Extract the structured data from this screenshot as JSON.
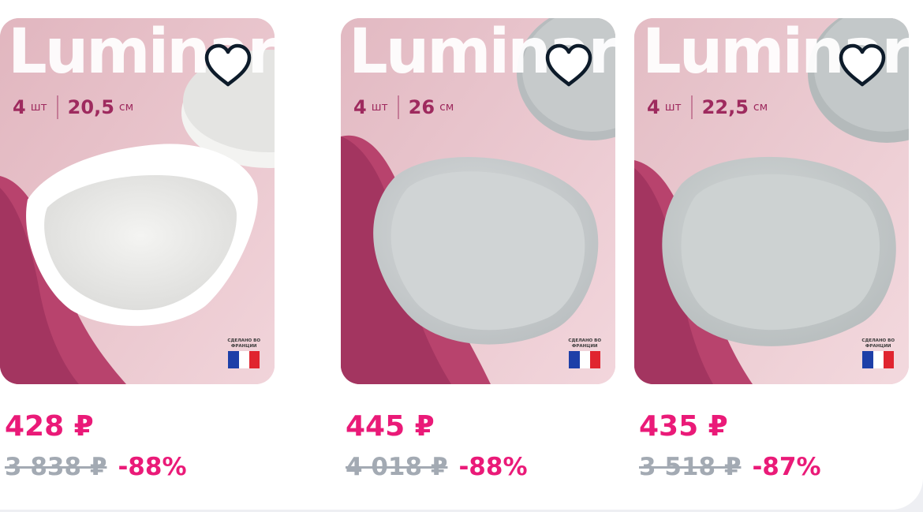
{
  "products": [
    {
      "brand": "Luminarc",
      "qty_value": "4",
      "qty_unit": "шт",
      "size_value": "26",
      "size_unit": "см",
      "made_in_line1": "СДЕЛАНО ВО",
      "made_in_line2": "ФРАНЦИИ",
      "price": "445 ₽",
      "old_price": "4 018 ₽",
      "discount": "-88%",
      "image_subject": "grey-plate"
    },
    {
      "brand": "Luminarc",
      "qty_value": "4",
      "qty_unit": "шт",
      "size_value": "22,5",
      "size_unit": "см",
      "made_in_line1": "СДЕЛАНО ВО",
      "made_in_line2": "ФРАНЦИИ",
      "price": "435 ₽",
      "old_price": "3 518 ₽",
      "discount": "-87%",
      "image_subject": "grey-plate"
    },
    {
      "brand": "Luminarc",
      "qty_value": "4",
      "qty_unit": "шт",
      "size_value": "20,5",
      "size_unit": "см",
      "made_in_line1": "СДЕЛАНО ВО",
      "made_in_line2": "ФРАНЦИИ",
      "price": "428 ₽",
      "old_price": "3 838 ₽",
      "discount": "-88%",
      "image_subject": "white-bowl"
    }
  ],
  "icons": {
    "favorite": "heart-icon",
    "flag": "france-flag-icon"
  },
  "colors": {
    "price": "#ea1a78",
    "old_price": "#a3aab3",
    "discount": "#ea1a78",
    "background": "#ffffff"
  }
}
